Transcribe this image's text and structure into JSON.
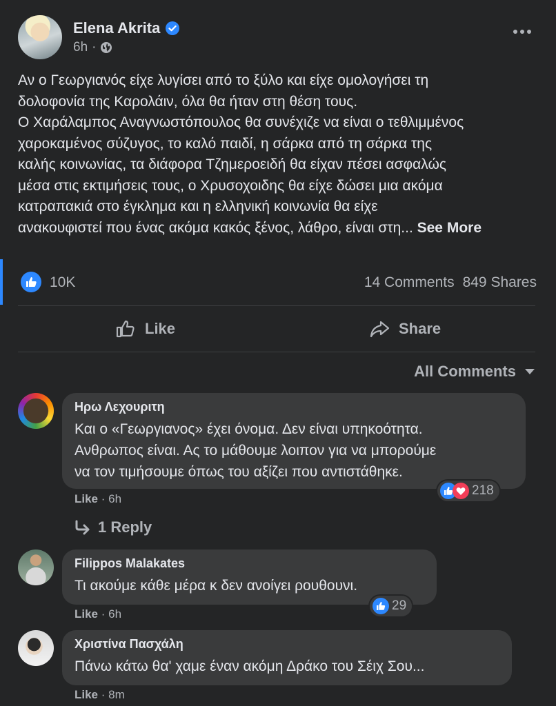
{
  "post": {
    "author": "Elena Akrita",
    "time": "6h",
    "text_lines": [
      "Αν ο Γεωργιανός είχε λυγίσει από το ξύλο και είχε ομολογήσει τη",
      "δολοφονία της Καρολάιν, όλα θα ήταν στη θέση τους.",
      "Ο Χαράλαμπος Αναγνωστόπουλος θα συνέχιζε να είναι ο τεθλιμμένος",
      "χαροκαμένος σύζυγος, το καλό παιδί, η σάρκα από τη σάρκα της",
      "καλής κοινωνίας, τα διάφορα Τζημεροειδή θα είχαν πέσει ασφαλώς",
      "μέσα στις εκτιμήσεις τους, ο Χρυσοχοιδης θα είχε δώσει μια ακόμα",
      "κατραπακιά στο έγκλημα και η ελληνική κοινωνία θα είχε",
      "ανακουφιστεί που ένας ακόμα κακός ξένος, λάθρο, είναι στη..."
    ],
    "see_more": "See More",
    "likes": "10K",
    "comments_count": "14 Comments",
    "shares_count": "849 Shares"
  },
  "actions": {
    "like": "Like",
    "share": "Share"
  },
  "filter": {
    "label": "All Comments"
  },
  "comments": [
    {
      "name": "Ηρω Λεχουριτη",
      "lines": [
        "Και ο «Γεωργιανος» έχει όνομα. Δεν είναι υπηκοότητα.",
        "Ανθρωπος είναι. Ας το μάθουμε λοιπον για να μπορούμε",
        "να τον τιμήσουμε όπως του αξίζει που αντιστάθηκε."
      ],
      "like": "Like",
      "time": "6h",
      "reactions": "218",
      "replies": "1 Reply"
    },
    {
      "name": "Filippos Malakates",
      "lines": [
        "Τι ακούμε κάθε μέρα κ δεν ανοίγει ρουθουνι."
      ],
      "like": "Like",
      "time": "6h",
      "reactions": "29"
    },
    {
      "name": "Χριστίνα Πασχάλη",
      "lines": [
        "Πάνω κάτω θα' χαμε έναν ακόμη Δράκο του Σέιχ Σου..."
      ],
      "like": "Like",
      "time": "8m"
    }
  ],
  "colors": {
    "background": "#242526",
    "bubble": "#3a3b3c",
    "accent": "#2d88ff",
    "love": "#f33e58",
    "muted": "#b0b3b8"
  },
  "icons": [
    "verified-icon",
    "globe-icon",
    "more-icon",
    "like-reaction-icon",
    "love-reaction-icon",
    "thumbs-up-icon",
    "share-arrow-icon",
    "dropdown-caret-icon",
    "reply-arrow-icon"
  ]
}
